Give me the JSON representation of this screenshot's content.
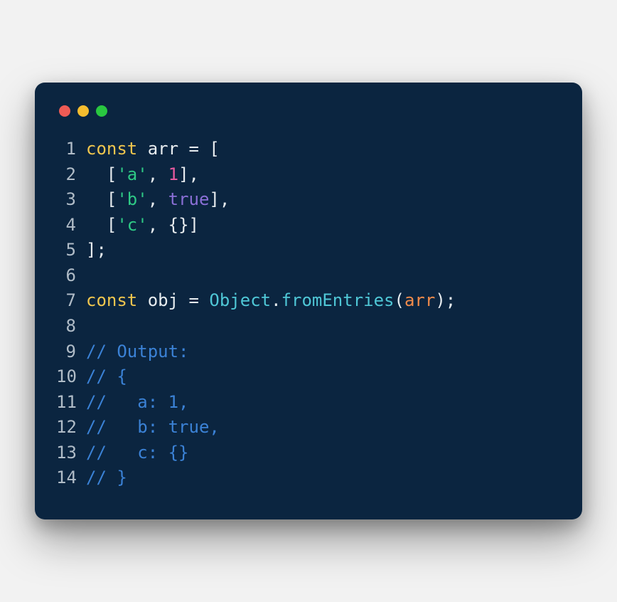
{
  "window": {
    "dots": [
      "red",
      "yellow",
      "green"
    ]
  },
  "code": {
    "lines": [
      {
        "num": "1",
        "tokens": [
          {
            "cls": "tk-keyword",
            "text": "const"
          },
          {
            "cls": "tk-ident",
            "text": " arr "
          },
          {
            "cls": "tk-punct",
            "text": "= ["
          }
        ]
      },
      {
        "num": "2",
        "tokens": [
          {
            "cls": "tk-punct",
            "text": "  ["
          },
          {
            "cls": "tk-string",
            "text": "'a'"
          },
          {
            "cls": "tk-punct",
            "text": ", "
          },
          {
            "cls": "tk-number",
            "text": "1"
          },
          {
            "cls": "tk-punct",
            "text": "],"
          }
        ]
      },
      {
        "num": "3",
        "tokens": [
          {
            "cls": "tk-punct",
            "text": "  ["
          },
          {
            "cls": "tk-string",
            "text": "'b'"
          },
          {
            "cls": "tk-punct",
            "text": ", "
          },
          {
            "cls": "tk-bool",
            "text": "true"
          },
          {
            "cls": "tk-punct",
            "text": "],"
          }
        ]
      },
      {
        "num": "4",
        "tokens": [
          {
            "cls": "tk-punct",
            "text": "  ["
          },
          {
            "cls": "tk-string",
            "text": "'c'"
          },
          {
            "cls": "tk-punct",
            "text": ", {}]"
          }
        ]
      },
      {
        "num": "5",
        "tokens": [
          {
            "cls": "tk-punct",
            "text": "];"
          }
        ]
      },
      {
        "num": "6",
        "tokens": [
          {
            "cls": "tk-punct",
            "text": ""
          }
        ]
      },
      {
        "num": "7",
        "tokens": [
          {
            "cls": "tk-keyword",
            "text": "const"
          },
          {
            "cls": "tk-ident",
            "text": " obj "
          },
          {
            "cls": "tk-punct",
            "text": "= "
          },
          {
            "cls": "tk-class",
            "text": "Object"
          },
          {
            "cls": "tk-punct",
            "text": "."
          },
          {
            "cls": "tk-method",
            "text": "fromEntries"
          },
          {
            "cls": "tk-punct",
            "text": "("
          },
          {
            "cls": "tk-param",
            "text": "arr"
          },
          {
            "cls": "tk-punct",
            "text": ");"
          }
        ]
      },
      {
        "num": "8",
        "tokens": [
          {
            "cls": "tk-punct",
            "text": ""
          }
        ]
      },
      {
        "num": "9",
        "tokens": [
          {
            "cls": "tk-comment",
            "text": "// Output:"
          }
        ]
      },
      {
        "num": "10",
        "tokens": [
          {
            "cls": "tk-comment",
            "text": "// {"
          }
        ]
      },
      {
        "num": "11",
        "tokens": [
          {
            "cls": "tk-comment",
            "text": "//   a: 1,"
          }
        ]
      },
      {
        "num": "12",
        "tokens": [
          {
            "cls": "tk-comment",
            "text": "//   b: true,"
          }
        ]
      },
      {
        "num": "13",
        "tokens": [
          {
            "cls": "tk-comment",
            "text": "//   c: {}"
          }
        ]
      },
      {
        "num": "14",
        "tokens": [
          {
            "cls": "tk-comment",
            "text": "// }"
          }
        ]
      }
    ]
  }
}
